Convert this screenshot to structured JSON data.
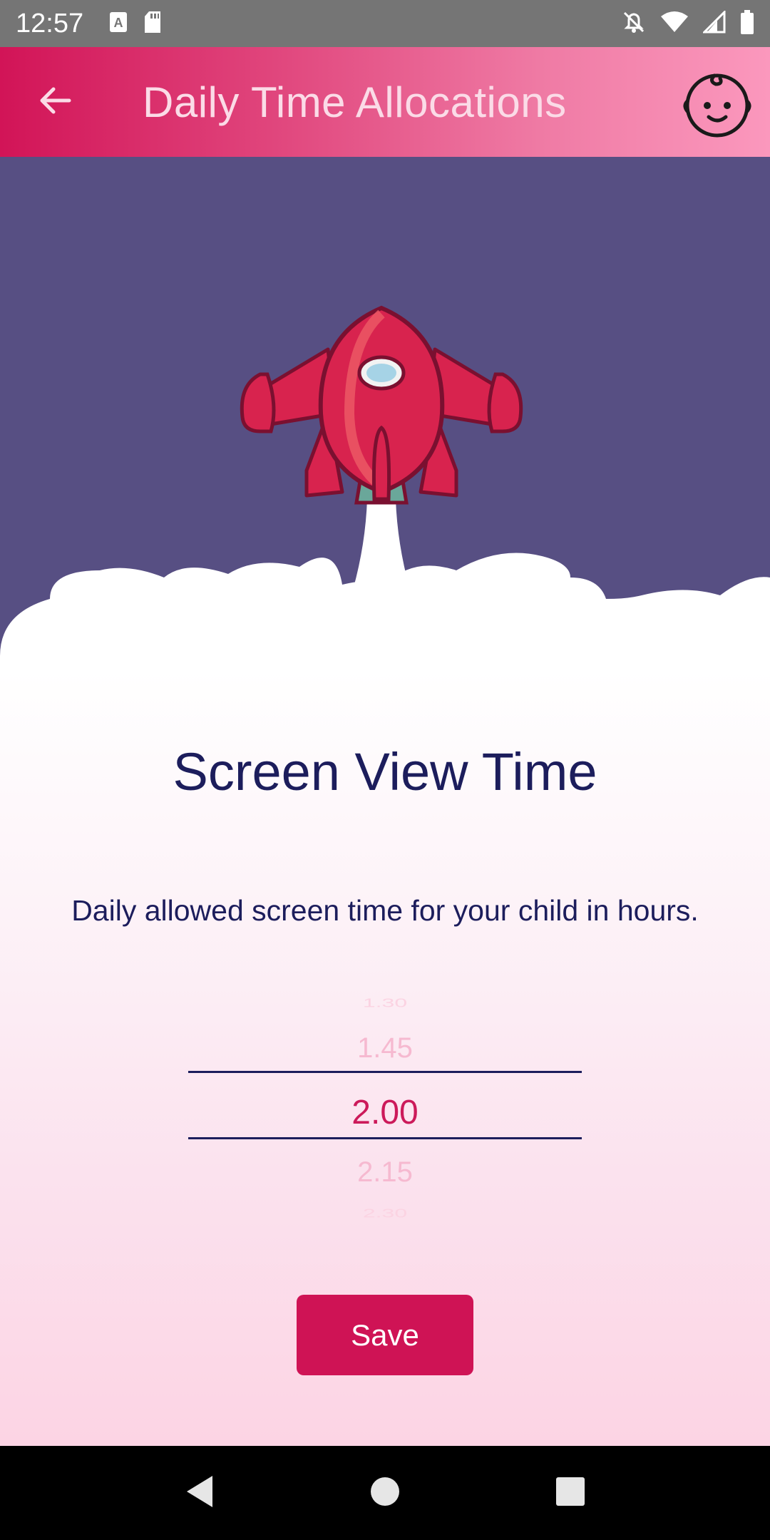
{
  "status_bar": {
    "time": "12:57",
    "icons": [
      "text-a-icon",
      "sd-card-icon",
      "do-not-disturb-icon",
      "wifi-icon",
      "signal-icon",
      "battery-icon"
    ]
  },
  "app_bar": {
    "title": "Daily Time Allocations",
    "back_icon": "arrow-back-icon",
    "avatar_icon": "baby-face-icon"
  },
  "hero": {
    "illustration": "rocket-launch-icon"
  },
  "main": {
    "title": "Screen View Time",
    "subtitle": "Daily allowed screen time for your child in hours.",
    "picker": {
      "options": [
        "1.30",
        "1.45",
        "2.00",
        "2.15",
        "2.30"
      ],
      "selected": "2.00"
    },
    "save_label": "Save"
  },
  "nav_bar": {
    "icons": [
      "back-triangle-icon",
      "home-circle-icon",
      "recents-square-icon"
    ]
  },
  "colors": {
    "accent": "#cf1355",
    "title_text": "#1c1d5c",
    "hero_bg": "#574f83"
  }
}
